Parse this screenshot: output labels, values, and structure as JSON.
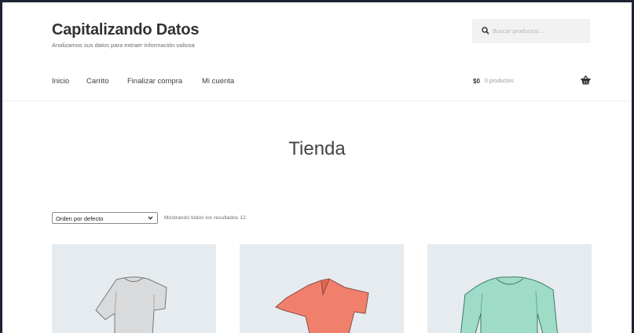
{
  "site": {
    "title": "Capitalizando Datos",
    "description": "Analizamos sus datos para extraer información valiosa"
  },
  "search": {
    "placeholder": "Buscar productos…",
    "icon": "search-icon"
  },
  "nav": {
    "items": [
      {
        "label": "Inicio"
      },
      {
        "label": "Carrito"
      },
      {
        "label": "Finalizar compra"
      },
      {
        "label": "Mi cuenta"
      }
    ]
  },
  "cart": {
    "total": "$0",
    "count": "0 productos",
    "icon": "basket-icon"
  },
  "page": {
    "title": "Tienda"
  },
  "shop": {
    "orderby_selected": "Orden por defecto",
    "result_count": "Mostrando todos los resultados 12"
  },
  "products": [
    {
      "icon": "tshirt-icon",
      "color": "#d9dadb"
    },
    {
      "icon": "vneck-tshirt-icon",
      "color": "#f0806c"
    },
    {
      "icon": "sweatshirt-icon",
      "color": "#9fdcc8"
    }
  ],
  "colors": {
    "background": "#1c2333",
    "tile": "#e6ebef",
    "text": "#333333"
  }
}
